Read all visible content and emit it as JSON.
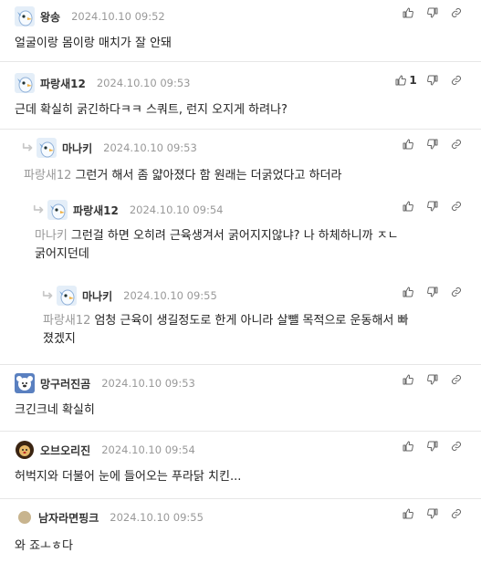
{
  "comments": [
    {
      "nick": "왕송",
      "time": "2024.10.10 09:52",
      "text": "얼굴이랑 몸이랑 매치가 잘 안돼",
      "mention": "",
      "like_count": ""
    },
    {
      "nick": "파랑새12",
      "time": "2024.10.10 09:53",
      "text": "근데 확실히 굵긴하다ㅋㅋ 스쿼트, 런지 오지게 하려나?",
      "mention": "",
      "like_count": "1"
    },
    {
      "nick": "마나키",
      "time": "2024.10.10 09:53",
      "text": "그런거 해서 좀 얇아졌다 함 원래는 더굵었다고 하더라",
      "mention": "파랑새12",
      "like_count": ""
    },
    {
      "nick": "파랑새12",
      "time": "2024.10.10 09:54",
      "text_line1": "그런걸 하면 오히려 근육생겨서 굵어지지않냐? 나 하체하니까 ㅈㄴ",
      "text_line2": "굵어지던데",
      "mention": "마나키",
      "like_count": ""
    },
    {
      "nick": "마나키",
      "time": "2024.10.10 09:55",
      "text_line1": "엄청 근육이 생길정도로 한게 아니라 살뺄 목적으로 운동해서 빠",
      "text_line2": "졌겠지",
      "mention": "파랑새12",
      "like_count": ""
    },
    {
      "nick": "망구러진곰",
      "time": "2024.10.10 09:53",
      "text": "크긴크네 확실히",
      "mention": "",
      "like_count": ""
    },
    {
      "nick": "오브오리진",
      "time": "2024.10.10 09:54",
      "text": "허벅지와 더불어 눈에 들어오는 푸라닭 치킨...",
      "mention": "",
      "like_count": ""
    },
    {
      "nick": "남자라면핑크",
      "time": "2024.10.10 09:55",
      "text": "와 죠ㅗㅎ다",
      "mention": "",
      "like_count": ""
    }
  ],
  "icons": {
    "like": "thumbs-up-icon",
    "dislike": "thumbs-down-icon",
    "share": "link-icon",
    "reply": "reply-arrow-icon"
  },
  "colors": {
    "divider": "#e6e6e6",
    "meta": "#999999",
    "mention": "#999999"
  }
}
